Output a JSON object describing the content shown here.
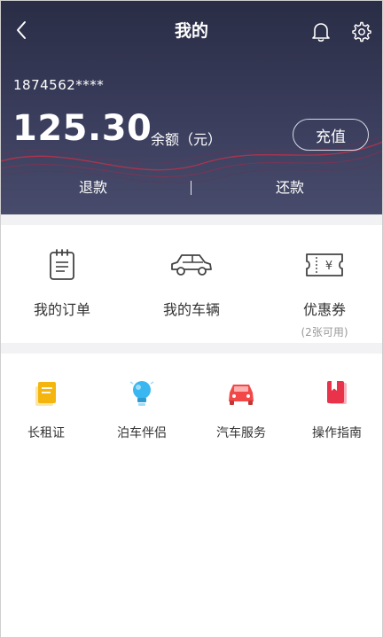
{
  "header": {
    "title": "我的",
    "account": "1874562****",
    "balance": "125.30",
    "balance_label": "余额（元）",
    "recharge_label": "充值",
    "refund_label": "退款",
    "repay_label": "还款"
  },
  "quick_actions": [
    {
      "label": "我的订单",
      "icon": "clipboard-icon"
    },
    {
      "label": "我的车辆",
      "icon": "car-icon"
    },
    {
      "label": "优惠券",
      "sub": "(2张可用)",
      "icon": "coupon-icon"
    }
  ],
  "services": [
    {
      "label": "长租证",
      "icon": "card-icon",
      "color": "#f5b50f"
    },
    {
      "label": "泊车伴侣",
      "icon": "lightbulb-icon",
      "color": "#3ab7f0"
    },
    {
      "label": "汽车服务",
      "icon": "car-service-icon",
      "color": "#f24848"
    },
    {
      "label": "操作指南",
      "icon": "book-icon",
      "color": "#e8334a"
    }
  ],
  "colors": {
    "header_dark": "#2a2d45",
    "accent_red": "#e8334a",
    "divider": "#f2f2f5"
  }
}
